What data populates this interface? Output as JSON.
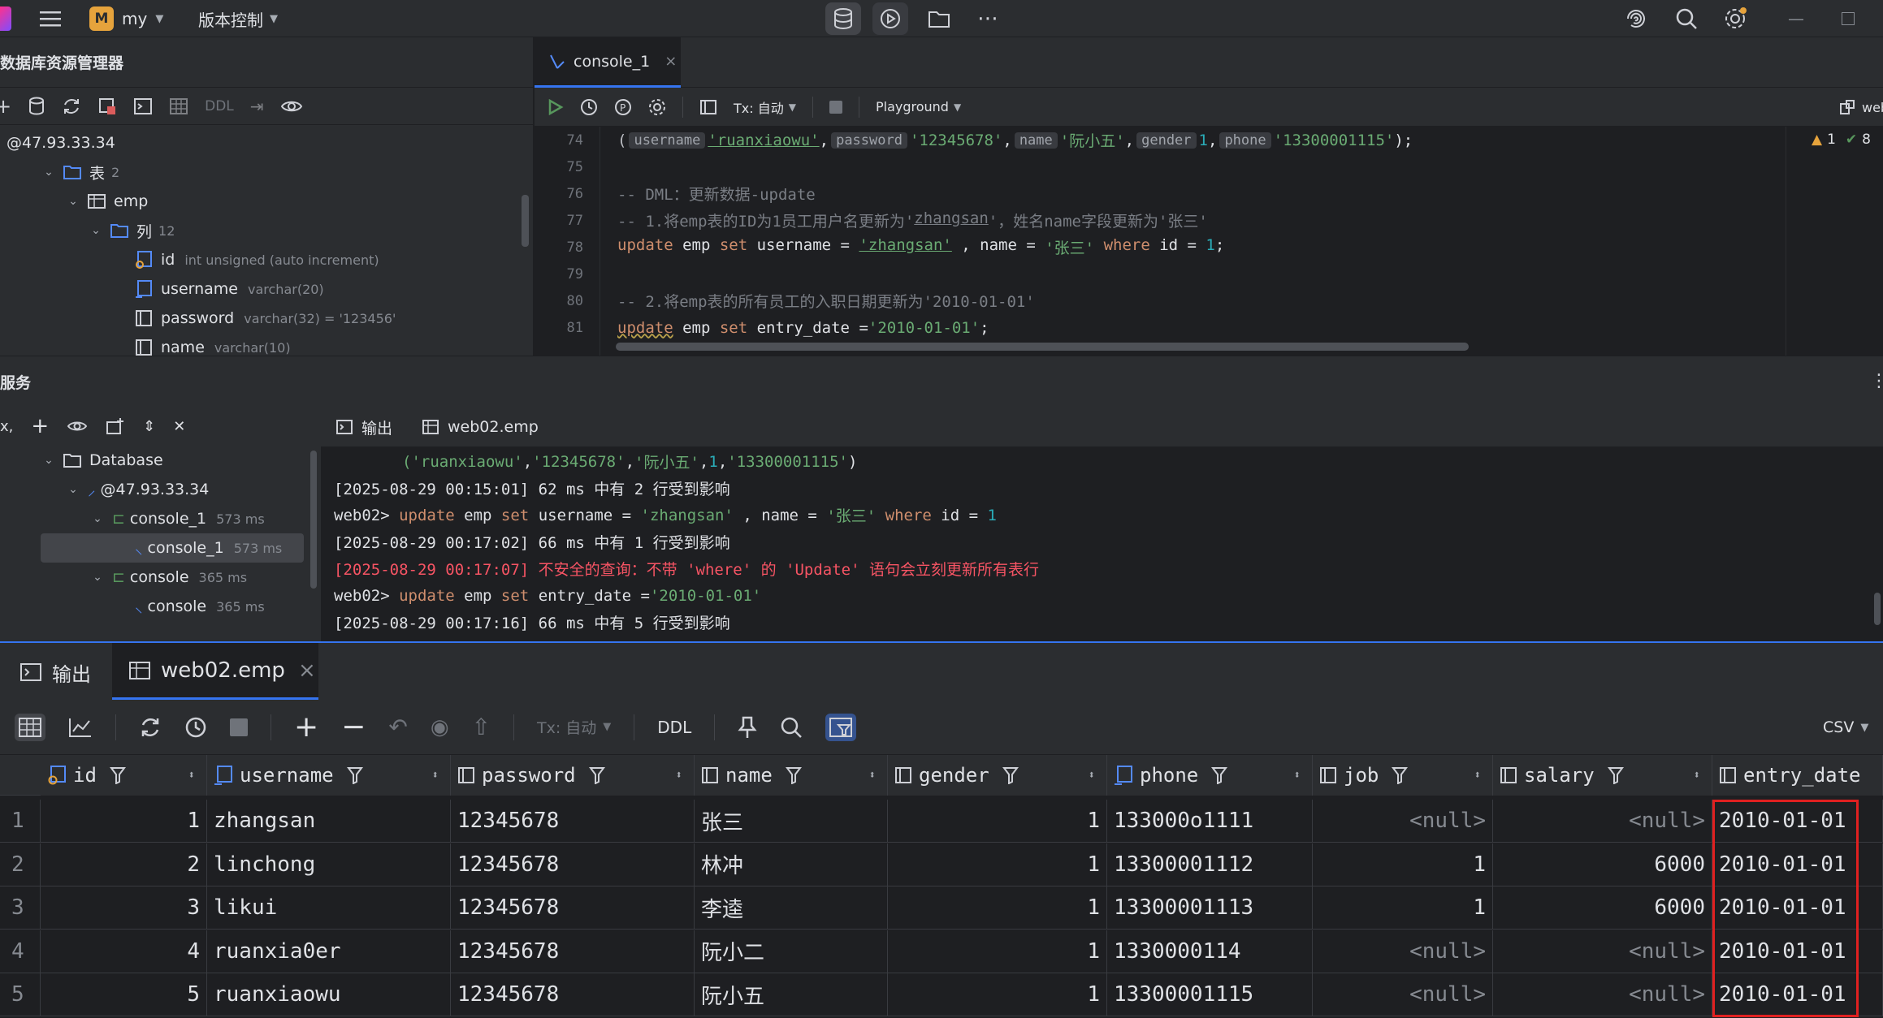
{
  "titlebar": {
    "project_badge": "M",
    "project_name": "my",
    "vcs_menu": "版本控制"
  },
  "explorer": {
    "title": "数据库资源管理器",
    "toolbar_ddl": "DDL",
    "host": "@47.93.33.34",
    "tables_label": "表",
    "tables_count": "2",
    "table_name": "emp",
    "columns_label": "列",
    "columns_count": "12",
    "columns": [
      {
        "name": "id",
        "type": "int unsigned (auto increment)"
      },
      {
        "name": "username",
        "type": "varchar(20)"
      },
      {
        "name": "password",
        "type": "varchar(32) = '123456'"
      },
      {
        "name": "name",
        "type": "varchar(10)"
      }
    ]
  },
  "editor": {
    "tab_label": "console_1",
    "tx_label": "Tx: 自动",
    "playground_label": "Playground",
    "right_label": "web",
    "warnings": "1",
    "checks": "8",
    "lines": [
      {
        "n": "74",
        "hints": [
          "username",
          "password",
          "name",
          "gender",
          "phone"
        ],
        "values": [
          "'ruanxiaowu'",
          "'12345678'",
          "'阮小五'",
          "1",
          "'13300001115'"
        ]
      },
      {
        "n": "75"
      },
      {
        "n": "76",
        "text": "-- DML：更新数据-update"
      },
      {
        "n": "77",
        "text_a": "-- 1.将emp表的ID为1员工用户名更新为'",
        "text_b": "zhangsan",
        "text_c": "'，姓名name字段更新为'张三'"
      },
      {
        "n": "78",
        "kw1": "update",
        "t1": " emp ",
        "kw2": "set",
        "t2": " username = ",
        "s1": "'zhangsan'",
        "t3": " , name = ",
        "s2": "'张三'",
        "kw3": " where",
        "t4": " id = ",
        "num": "1",
        "t5": ";"
      },
      {
        "n": "79"
      },
      {
        "n": "80",
        "text": "-- 2.将emp表的所有员工的入职日期更新为'2010-01-01'"
      },
      {
        "n": "81",
        "kw1": "update",
        "t1": " emp ",
        "kw2": "set",
        "t2": " entry_date =",
        "s1": "'2010-01-01'",
        "t3": ";"
      }
    ]
  },
  "services": {
    "title": "服务",
    "tree": {
      "database": "Database",
      "host": "@47.93.33.34",
      "console1_group": "console_1",
      "console1_group_time": "573 ms",
      "console1_item": "console_1",
      "console1_item_time": "573 ms",
      "console_group": "console",
      "console_group_time": "365 ms",
      "console_item": "console",
      "console_item_time": "365 ms"
    },
    "tabs": [
      "输出",
      "web02.emp"
    ],
    "output": [
      {
        "type": "values",
        "parts": [
          "('ruanxiaowu'",
          ",",
          "'12345678'",
          ",",
          "'阮小五'",
          ",",
          "1",
          ",",
          "'13300001115'",
          ")"
        ]
      },
      {
        "type": "plain",
        "text": "[2025-08-29 00:15:01] 62 ms 中有 2 行受到影响"
      },
      {
        "type": "sql1",
        "prompt": "web02> ",
        "kw1": "update",
        "t1": " emp ",
        "kw2": "set",
        "t2": " username = ",
        "s1": "'zhangsan'",
        "t3": " , name = ",
        "s2": "'张三'",
        "kw3": " where",
        "t4": " id = ",
        "num": "1"
      },
      {
        "type": "plain",
        "text": "[2025-08-29 00:17:02] 66 ms 中有 1 行受到影响"
      },
      {
        "type": "error",
        "text": "[2025-08-29 00:17:07] 不安全的查询：不带 'where' 的 'Update' 语句会立刻更新所有表行"
      },
      {
        "type": "sql2",
        "prompt": "web02> ",
        "kw1": "update",
        "t1": " emp ",
        "kw2": "set",
        "t2": " entry_date =",
        "s1": "'2010-01-01'"
      },
      {
        "type": "plain",
        "text": "[2025-08-29 00:17:16] 66 ms 中有 5 行受到影响"
      }
    ]
  },
  "results": {
    "tabs": [
      "输出",
      "web02.emp"
    ],
    "tx_label": "Tx: 自动",
    "ddl_label": "DDL",
    "export_label": "CSV",
    "columns": [
      "id",
      "username",
      "password",
      "name",
      "gender",
      "phone",
      "job",
      "salary",
      "entry_date"
    ],
    "rows": [
      {
        "n": "1",
        "id": "1",
        "username": "zhangsan",
        "password": "12345678",
        "name": "张三",
        "gender": "1",
        "phone": "133000o1111",
        "job": "<null>",
        "salary": "<null>",
        "entry_date": "2010-01-01"
      },
      {
        "n": "2",
        "id": "2",
        "username": "linchong",
        "password": "12345678",
        "name": "林冲",
        "gender": "1",
        "phone": "13300001112",
        "job": "1",
        "salary": "6000",
        "entry_date": "2010-01-01"
      },
      {
        "n": "3",
        "id": "3",
        "username": "likui",
        "password": "12345678",
        "name": "李逵",
        "gender": "1",
        "phone": "13300001113",
        "job": "1",
        "salary": "6000",
        "entry_date": "2010-01-01"
      },
      {
        "n": "4",
        "id": "4",
        "username": "ruanxia0er",
        "password": "12345678",
        "name": "阮小二",
        "gender": "1",
        "phone": "1330000114",
        "job": "<null>",
        "salary": "<null>",
        "entry_date": "2010-01-01"
      },
      {
        "n": "5",
        "id": "5",
        "username": "ruanxiaowu",
        "password": "12345678",
        "name": "阮小五",
        "gender": "1",
        "phone": "13300001115",
        "job": "<null>",
        "salary": "<null>",
        "entry_date": "2010-01-01"
      }
    ]
  },
  "colors": {
    "highlight_box": "#e02020",
    "accent": "#3574f0"
  }
}
